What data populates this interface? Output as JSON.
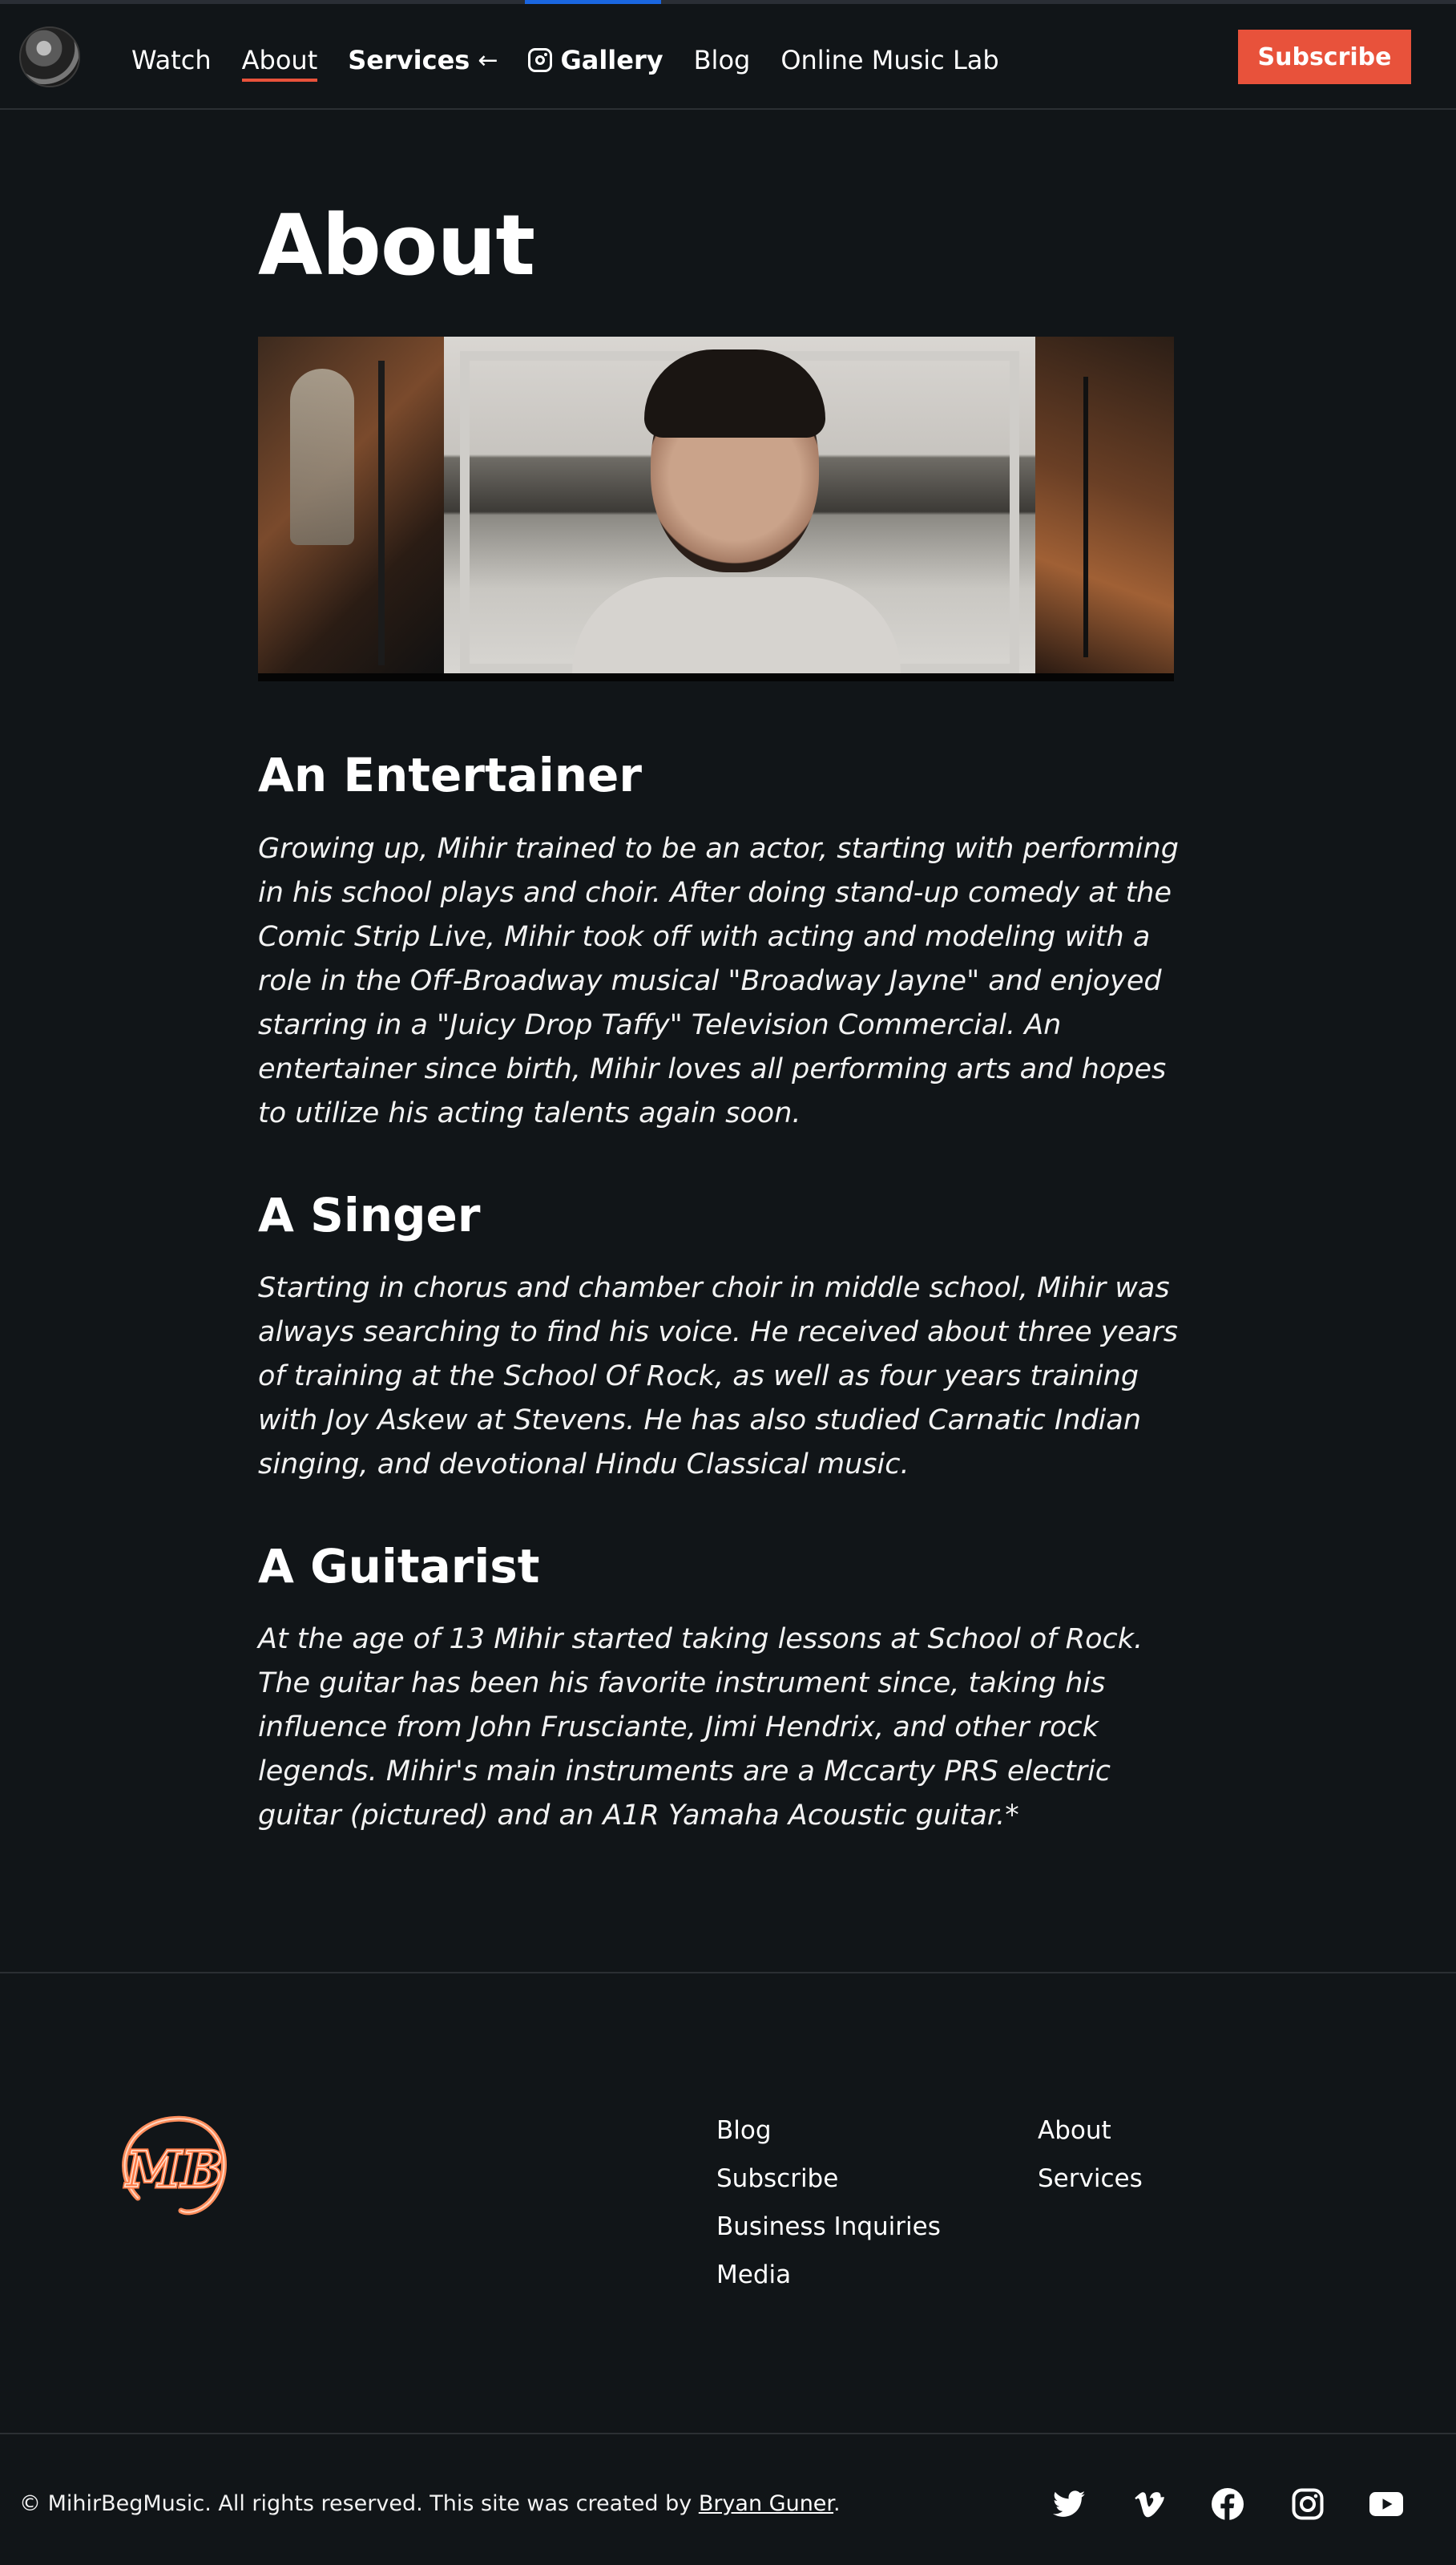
{
  "header": {
    "nav": {
      "watch": "Watch",
      "about": "About",
      "services": "Services",
      "services_arrow": "←",
      "gallery": "Gallery",
      "blog": "Blog",
      "online_music_lab": "Online Music Lab"
    },
    "subscribe_label": "Subscribe"
  },
  "main": {
    "title": "About",
    "sections": [
      {
        "heading": "An Entertainer",
        "body": "Growing up, Mihir trained to be an actor, starting with performing in his school plays and choir. After doing stand-up comedy at the Comic Strip Live, Mihir took off with acting and modeling with a role in the Off-Broadway musical \"Broadway Jayne\" and enjoyed starring in a \"Juicy Drop Taffy\" Television Commercial. An entertainer since birth, Mihir loves all performing arts and hopes to utilize his acting talents again soon."
      },
      {
        "heading": "A Singer",
        "body": "Starting in chorus and chamber choir in middle school, Mihir was always searching to find his voice. He received about three years of training at the School Of Rock, as well as four years training with Joy Askew at Stevens. He has also studied Carnatic Indian singing, and devotional Hindu Classical music."
      },
      {
        "heading": "A Guitarist",
        "body": "At the age of 13 Mihir started taking lessons at School of Rock. The guitar has been his favorite instrument since, taking his influence from John Frusciante, Jimi Hendrix, and other rock legends. Mihir's main instruments are a Mccarty PRS electric guitar (pictured) and an A1R Yamaha Acoustic guitar.*"
      }
    ]
  },
  "footer": {
    "logo_text": "MB",
    "links_col1": [
      "Blog",
      "Subscribe",
      "Business Inquiries",
      "Media"
    ],
    "links_col2": [
      "About",
      "Services"
    ],
    "copyright_prefix": "© MihirBegMusic. All rights reserved. This site was created by ",
    "copyright_author": "Bryan Guner",
    "copyright_suffix": ".",
    "social_icons": [
      "twitter-icon",
      "vimeo-icon",
      "facebook-icon",
      "instagram-icon",
      "youtube-icon"
    ]
  },
  "colors": {
    "background": "#111518",
    "accent": "#e8523b",
    "progress": "#1a66e0"
  }
}
